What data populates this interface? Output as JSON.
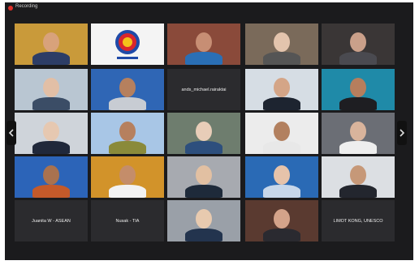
{
  "app": {
    "recording_label": "Recording"
  },
  "colors": {
    "window_bg": "#1b1b1d",
    "tile_bg": "#2b2b2e",
    "recording_dot": "#e0302a",
    "asean_blue": "#1f4aa8",
    "asean_red": "#d9262d",
    "asean_yellow": "#f4c21a"
  },
  "nav": {
    "prev_icon": "chevron-left-icon",
    "next_icon": "chevron-right-icon"
  },
  "tiles": [
    {
      "name": "",
      "kind": "video",
      "bg": "#c99a3a",
      "skin": "#d8a27b",
      "shirt": "#2d3d66"
    },
    {
      "name": "",
      "kind": "logo",
      "bg": "#f4f4f4"
    },
    {
      "name": "",
      "kind": "video",
      "bg": "#8a4a3a",
      "skin": "#c78e74",
      "shirt": "#2a6fb5"
    },
    {
      "name": "",
      "kind": "video",
      "bg": "#7a6a5a",
      "skin": "#e3c4ad",
      "shirt": "#555555"
    },
    {
      "name": "",
      "kind": "video",
      "bg": "#3a3636",
      "skin": "#caa08a",
      "shirt": "#4a4a50"
    },
    {
      "name": "",
      "kind": "video",
      "bg": "#b9c6d2",
      "skin": "#e2bfa6",
      "shirt": "#3b4d66"
    },
    {
      "name": "",
      "kind": "video",
      "bg": "#2f66b5",
      "skin": "#b6805e",
      "shirt": "#c8ccd3"
    },
    {
      "name": "ands_michael.rairaktai",
      "kind": "label"
    },
    {
      "name": "",
      "kind": "video",
      "bg": "#d6dde4",
      "skin": "#d4a587",
      "shirt": "#1d2430"
    },
    {
      "name": "",
      "kind": "video",
      "bg": "#1f8aa8",
      "skin": "#b67e5d",
      "shirt": "#1e1e22"
    },
    {
      "name": "",
      "kind": "video",
      "bg": "#cfd4da",
      "skin": "#e6c8b1",
      "shirt": "#20283a"
    },
    {
      "name": "",
      "kind": "video",
      "bg": "#a8c6e6",
      "skin": "#b6805e",
      "shirt": "#8a8a3a"
    },
    {
      "name": "",
      "kind": "video",
      "bg": "#6e7d6e",
      "skin": "#e8cdb8",
      "shirt": "#2d4f7d"
    },
    {
      "name": "",
      "kind": "video",
      "bg": "#ececec",
      "skin": "#b2805f",
      "shirt": "#e8e8e8"
    },
    {
      "name": "",
      "kind": "video",
      "bg": "#6b6e75",
      "skin": "#d9b49c",
      "shirt": "#eeeeee"
    },
    {
      "name": "",
      "kind": "video",
      "bg": "#2c64b8",
      "skin": "#a9724f",
      "shirt": "#c45a2a"
    },
    {
      "name": "",
      "kind": "video",
      "bg": "#d2932a",
      "skin": "#c48d6a",
      "shirt": "#f2f2f2"
    },
    {
      "name": "",
      "kind": "video",
      "bg": "#a7aab0",
      "skin": "#e2c0a2",
      "shirt": "#1e2a3a"
    },
    {
      "name": "",
      "kind": "video",
      "bg": "#2a6ab5",
      "skin": "#e6c3aa",
      "shirt": "#c7d7ea"
    },
    {
      "name": "",
      "kind": "video",
      "bg": "#dcdfe3",
      "skin": "#c69878",
      "shirt": "#23262e"
    },
    {
      "name": "Juanita W - ASEAN",
      "kind": "label"
    },
    {
      "name": "Nusak - TIA",
      "kind": "label"
    },
    {
      "name": "",
      "kind": "video",
      "bg": "#9aa0a8",
      "skin": "#e8caaf",
      "shirt": "#23344e"
    },
    {
      "name": "",
      "kind": "video",
      "bg": "#5a3a30",
      "skin": "#d4a38a",
      "shirt": "#2a2a30"
    },
    {
      "name": "LIMOT KONG, UNESCO",
      "kind": "label"
    }
  ]
}
